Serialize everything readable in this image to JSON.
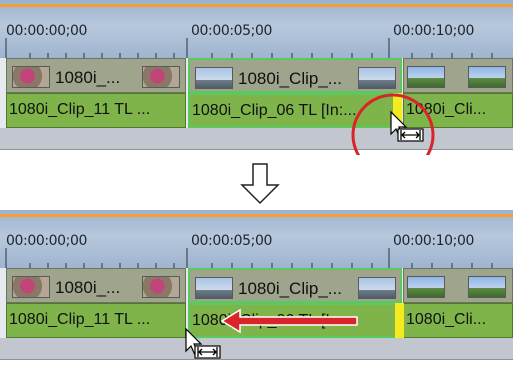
{
  "panels": {
    "before": {
      "timecodes": [
        "00:00:00;00",
        "00:00:05;00",
        "00:00:10;00"
      ],
      "video_clips": [
        "1080i_...",
        "1080i_Clip_...",
        ""
      ],
      "audio_clips": [
        "1080i_Clip_11  TL ...",
        "1080i_Clip_06  TL [In:...",
        "1080i_Cli..."
      ]
    },
    "after": {
      "timecodes": [
        "00:00:00;00",
        "00:00:05;00",
        "00:00:10;00"
      ],
      "video_clips": [
        "1080i_...",
        "1080i_Clip_...",
        ""
      ],
      "audio_clips": [
        "1080i_Clip_11  TL ...",
        "1080i_Clip_06  TL [In:...",
        "1080i_Cli..."
      ]
    }
  },
  "icons": {
    "step_arrow": "hollow-down-arrow-icon",
    "trim_cursor": "trim-cursor-icon",
    "highlight": "red-circle-highlight",
    "drag_direction": "red-left-arrow-icon"
  },
  "colors": {
    "ruler": "#b7c8dc",
    "ruler_accent": "#f2a033",
    "video_clip": "#9fa48c",
    "audio_clip": "#7fb44a",
    "selection": "#5cc95e",
    "trim_marker": "#f4ea1d",
    "highlight": "#d9242a"
  }
}
